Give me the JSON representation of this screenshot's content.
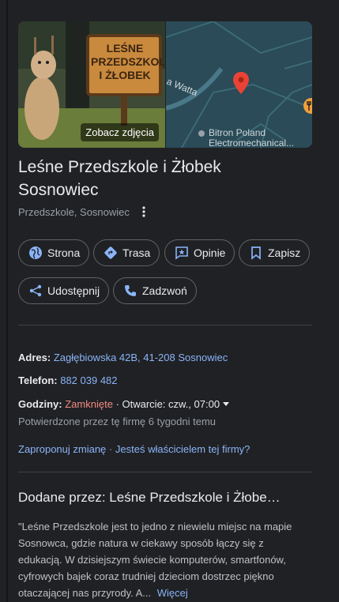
{
  "photos": {
    "see_photos_label": "Zobacz zdjęcia"
  },
  "map": {
    "street_label": "a Watta",
    "poi_label_line1": "Bitron Poland",
    "poi_label_line2": "Electromechanical..."
  },
  "place": {
    "title": "Leśne Przedszkole i Żłobek Sosnowiec",
    "subtitle": "Przedszkole, Sosnowiec"
  },
  "actions": [
    {
      "label": "Strona",
      "icon": "globe-icon"
    },
    {
      "label": "Trasa",
      "icon": "directions-icon"
    },
    {
      "label": "Opinie",
      "icon": "review-icon"
    },
    {
      "label": "Zapisz",
      "icon": "bookmark-icon"
    },
    {
      "label": "Udostępnij",
      "icon": "share-icon"
    },
    {
      "label": "Zadzwoń",
      "icon": "phone-icon"
    }
  ],
  "info": {
    "address_label": "Adres:",
    "address_value": "Zagłębiowska 42B, 41-208 Sosnowiec",
    "phone_label": "Telefon:",
    "phone_value": "882 039 482",
    "hours_label": "Godziny:",
    "hours_status": "Zamknięte",
    "hours_next": "· Otwarcie: czw., 07:00",
    "hours_confirmed": "Potwierdzone przez tę firmę 6 tygodni temu",
    "suggest_edit": "Zaproponuj zmianę",
    "separator": "·",
    "own_business": "Jesteś właścicielem tej firmy?"
  },
  "description": {
    "title": "Dodane przez: Leśne Przedszkole i Żłobe…",
    "text": "\"Leśne Przedszkole jest to jedno z niewielu miejsc na mapie Sosnowca, gdzie natura w ciekawy sposób łączy się z edukacją. W dzisiejszym świecie komputerów, smartfonów, cyfrowych bajek coraz trudniej dzieciom dostrzec piękno otaczającej nas przyrody. A...",
    "more_label": "Więcej"
  },
  "colors": {
    "background": "#202124",
    "link": "#8ab4f8",
    "closed": "#f28b82"
  }
}
